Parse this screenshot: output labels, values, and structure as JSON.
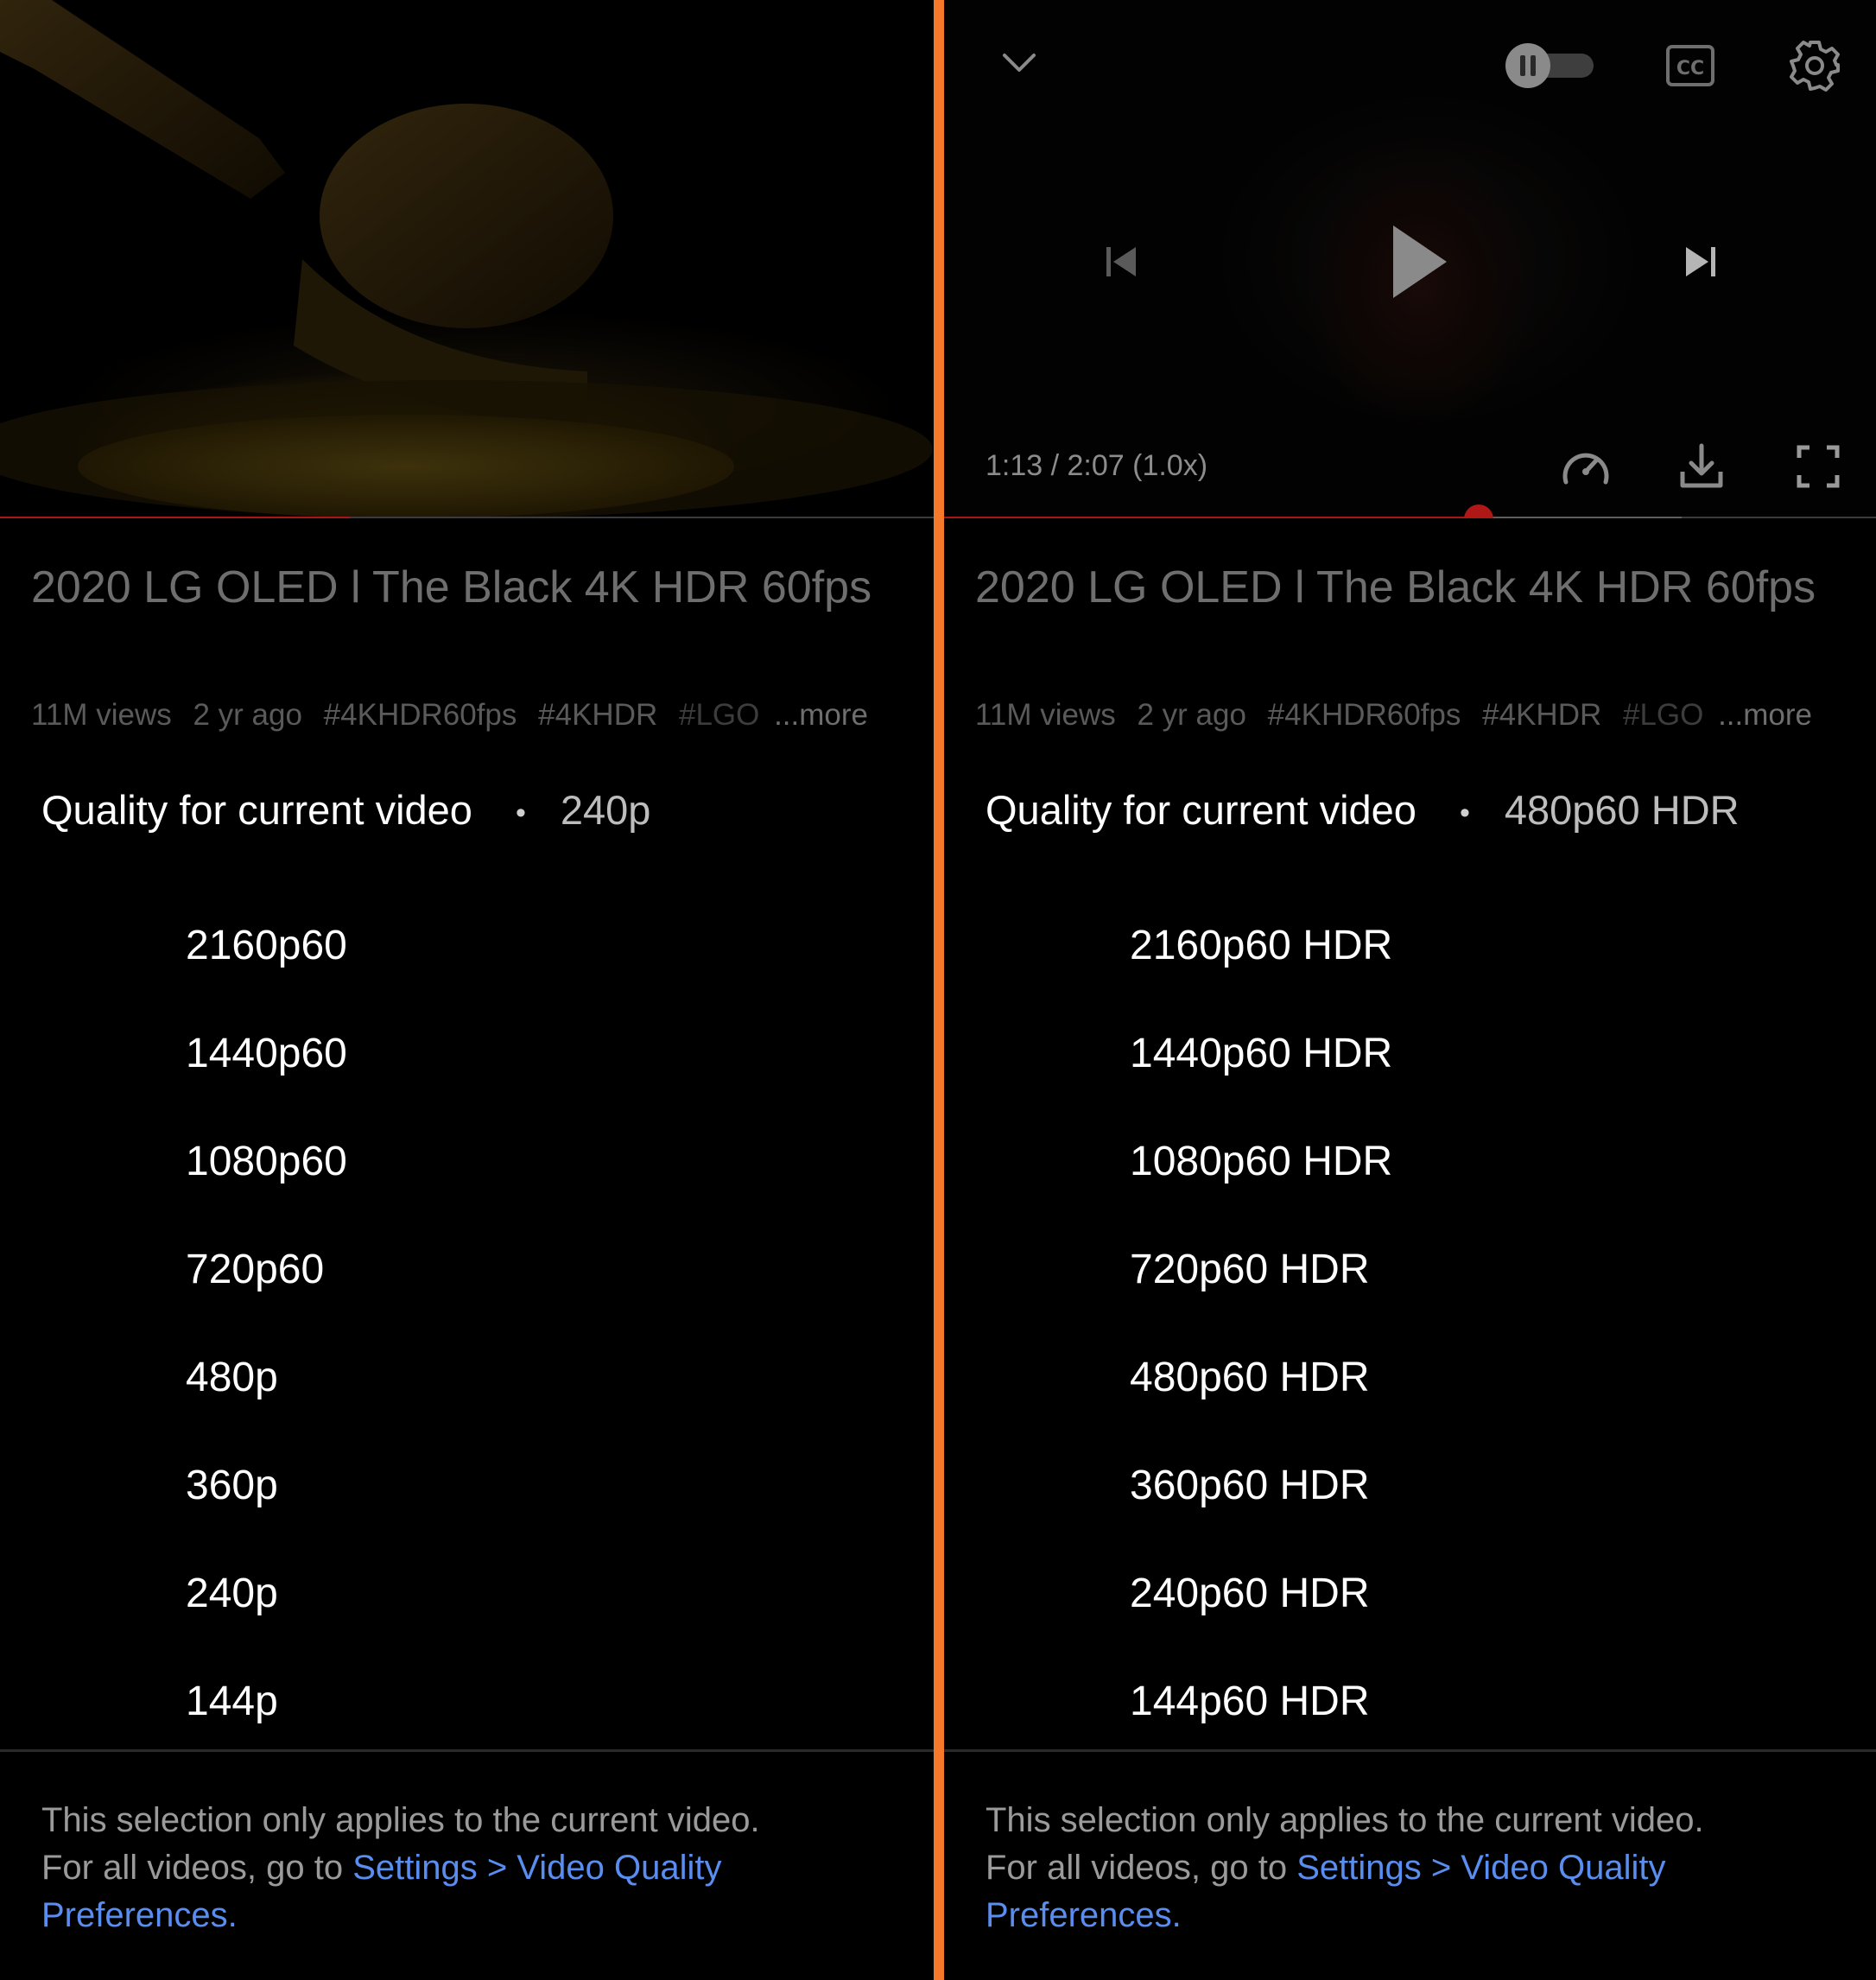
{
  "accent_color": "#f4792b",
  "link_color": "#5a8df0",
  "progress_color": "#a81616",
  "left": {
    "video_title": "2020 LG OLED l  The Black 4K HDR 60fps",
    "meta": {
      "views": "11M views",
      "age": "2 yr ago",
      "tags": [
        "#4KHDR60fps",
        "#4KHDR",
        "#LGO"
      ],
      "more": "...more"
    },
    "progress_fraction": 0.375,
    "quality_header": "Quality for current video",
    "quality_current": "240p",
    "options": [
      "2160p60",
      "1440p60",
      "1080p60",
      "720p60",
      "480p",
      "360p",
      "240p",
      "144p"
    ],
    "footer_text_1": "This selection only applies to the current video.",
    "footer_text_2": "For all videos, go to ",
    "footer_link": "Settings > Video Quality Preferences."
  },
  "right": {
    "video_title": "2020 LG OLED l  The Black 4K HDR 60fps",
    "meta": {
      "views": "11M views",
      "age": "2 yr ago",
      "tags": [
        "#4KHDR60fps",
        "#4KHDR",
        "#LGO"
      ],
      "more": "...more"
    },
    "time_display": "1:13 / 2:07 (1.0x)",
    "progress_fraction": 0.573,
    "buffer_fraction": 0.79,
    "quality_header": "Quality for current video",
    "quality_current": "480p60 HDR",
    "options": [
      "2160p60 HDR",
      "1440p60 HDR",
      "1080p60 HDR",
      "720p60 HDR",
      "480p60 HDR",
      "360p60 HDR",
      "240p60 HDR",
      "144p60 HDR"
    ],
    "footer_text_1": "This selection only applies to the current video.",
    "footer_text_2": "For all videos, go to ",
    "footer_link": "Settings > Video Quality Preferences.",
    "icons": [
      "chevron-down-icon",
      "autoplay-toggle-icon",
      "captions-icon",
      "gear-icon",
      "previous-icon",
      "play-icon",
      "next-icon",
      "playback-speed-icon",
      "download-icon",
      "fullscreen-icon"
    ]
  }
}
